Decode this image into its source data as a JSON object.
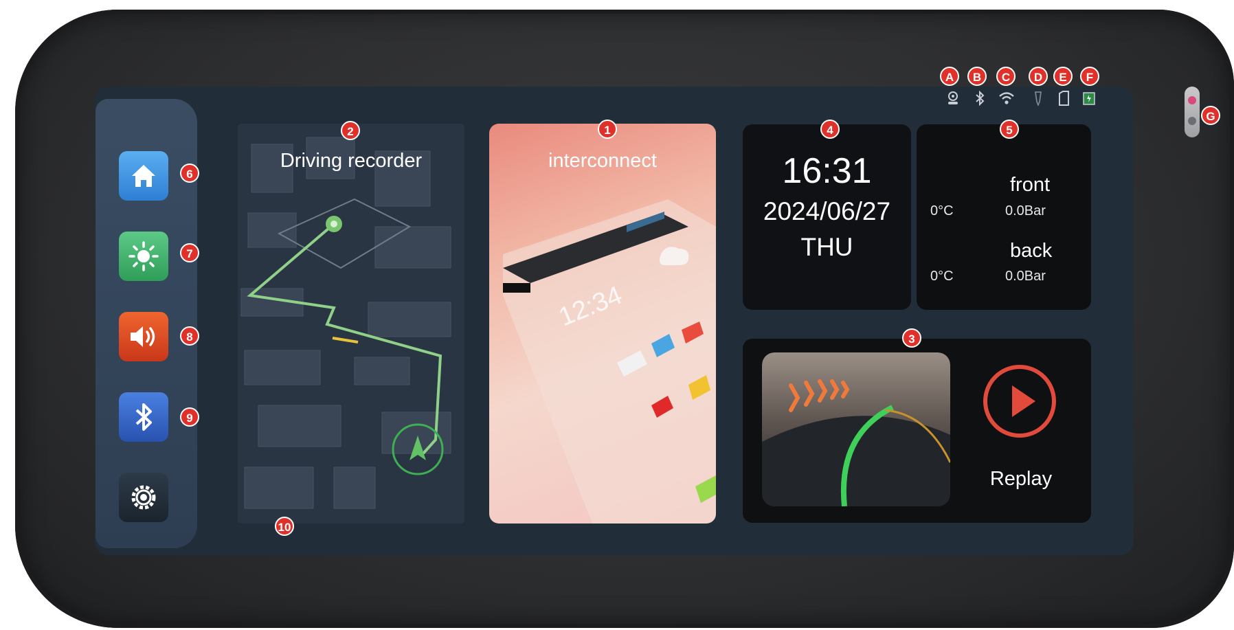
{
  "status_markers": [
    "A",
    "B",
    "C",
    "D",
    "E",
    "F",
    "G"
  ],
  "status_icons": [
    "gps-icon",
    "bluetooth-icon",
    "wifi-icon",
    "pen-icon",
    "sd-card-icon",
    "battery-icon"
  ],
  "sidebar": {
    "items": [
      {
        "name": "home",
        "marker": "6",
        "color": "#3a8fe0"
      },
      {
        "name": "brightness",
        "marker": "7",
        "color": "#3fb36a"
      },
      {
        "name": "volume",
        "marker": "8",
        "color": "#e2491f"
      },
      {
        "name": "bluetooth",
        "marker": "9",
        "color": "#3466c9"
      },
      {
        "name": "settings",
        "color": "#2a3644"
      }
    ]
  },
  "cards": {
    "driving_recorder": {
      "title": "Driving recorder",
      "marker": "2",
      "bottom_marker": "10"
    },
    "interconnect": {
      "title": "interconnect",
      "marker": "1",
      "phone_time": "12:34"
    },
    "clock": {
      "marker": "4",
      "time": "16:31",
      "date": "2024/06/27",
      "day": "THU"
    },
    "tire": {
      "marker": "5",
      "front_label": "front",
      "front_temp": "0°C",
      "front_pressure": "0.0Bar",
      "back_label": "back",
      "back_temp": "0°C",
      "back_pressure": "0.0Bar"
    },
    "replay": {
      "marker": "3",
      "label": "Replay",
      "accent": "#e24a3b"
    }
  }
}
